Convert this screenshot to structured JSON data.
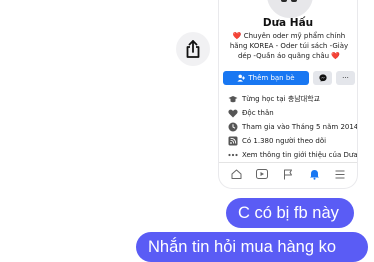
{
  "profile": {
    "name": "Dưa Hấu",
    "bio": "❤️ Chuyên oder mỹ phẩm chính hãng KOREA - Oder túi sách -Giày dép -Quần áo quãng châu ❤️",
    "add_friend_label": "Thêm bạn bè",
    "more_label": "···",
    "details": [
      {
        "icon": "graduation-cap-icon",
        "text": "Từng học tại 충남대학교"
      },
      {
        "icon": "heart-icon",
        "text": "Độc thân"
      },
      {
        "icon": "clock-icon",
        "text": "Tham gia vào Tháng 5 năm 2014"
      },
      {
        "icon": "rss-icon",
        "text": "Có 1.380 người theo dõi"
      },
      {
        "icon": "ellipsis-icon",
        "text": "Xem thông tin giới thiệu của Dưa"
      }
    ]
  },
  "tabbar": {
    "tabs": [
      "home-icon",
      "video-icon",
      "flag-icon",
      "notifications-icon",
      "menu-icon"
    ],
    "active_index": 3
  },
  "messages": [
    {
      "text": "C có bị fb này"
    },
    {
      "text": "Nhắn tin hỏi mua hàng ko"
    }
  ],
  "colors": {
    "bubble": "#5a5cf5",
    "facebook_blue": "#1877f2"
  }
}
